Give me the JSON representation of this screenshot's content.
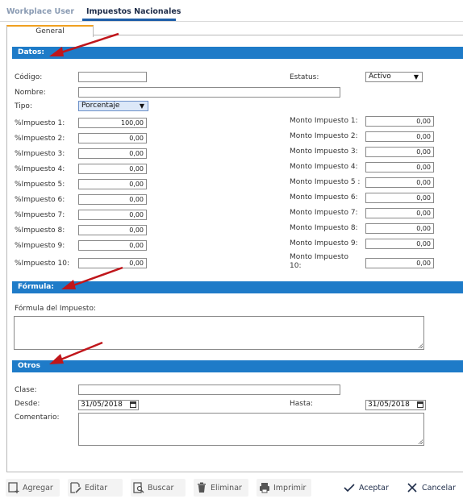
{
  "top_tabs": [
    "Workplace User",
    "Impuestos Nacionales"
  ],
  "subtab": "General",
  "sections": {
    "datos": "Datos:",
    "formula": "Fórmula:",
    "otros": "Otros"
  },
  "fields": {
    "codigo_label": "Código:",
    "codigo_value": "",
    "nombre_label": "Nombre:",
    "nombre_value": "",
    "tipo_label": "Tipo:",
    "tipo_value": "Porcentaje",
    "estatus_label": "Estatus:",
    "estatus_value": "Activo"
  },
  "impuestos": [
    {
      "label": "%Impuesto 1:",
      "value": "100,00"
    },
    {
      "label": "%Impuesto 2:",
      "value": "0,00"
    },
    {
      "label": "%Impuesto 3:",
      "value": "0,00"
    },
    {
      "label": "%Impuesto 4:",
      "value": "0,00"
    },
    {
      "label": "%Impuesto 5:",
      "value": "0,00"
    },
    {
      "label": "%Impuesto 6:",
      "value": "0,00"
    },
    {
      "label": "%Impuesto 7:",
      "value": "0,00"
    },
    {
      "label": "%Impuesto 8:",
      "value": "0,00"
    },
    {
      "label": "%Impuesto 9:",
      "value": "0,00"
    },
    {
      "label": "%Impuesto 10:",
      "value": "0,00"
    }
  ],
  "montos": [
    {
      "label": "Monto Impuesto 1:",
      "value": "0,00"
    },
    {
      "label": "Monto Impuesto 2:",
      "value": "0,00"
    },
    {
      "label": "Monto Impuesto 3:",
      "value": "0,00"
    },
    {
      "label": "Monto Impuesto 4:",
      "value": "0,00"
    },
    {
      "label": "Monto Impuesto 5 :",
      "value": "0,00"
    },
    {
      "label": "Monto Impuesto 6:",
      "value": "0,00"
    },
    {
      "label": "Monto Impuesto 7:",
      "value": "0,00"
    },
    {
      "label": "Monto Impuesto 8:",
      "value": "0,00"
    },
    {
      "label": "Monto Impuesto 9:",
      "value": "0,00"
    },
    {
      "label_line1": "Monto Impuesto",
      "label_line2": "10:",
      "value": "0,00"
    }
  ],
  "formula": {
    "label": "Fórmula del Impuesto:",
    "value": ""
  },
  "otros": {
    "clase_label": "Clase:",
    "clase_value": "",
    "desde_label": "Desde:",
    "desde_value": "31/05/2018",
    "hasta_label": "Hasta:",
    "hasta_value": "31/05/2018",
    "comentario_label": "Comentario:",
    "comentario_value": ""
  },
  "toolbar": {
    "agregar": "Agregar",
    "editar": "Editar",
    "buscar": "Buscar",
    "eliminar": "Eliminar",
    "imprimir": "Imprimir",
    "aceptar": "Aceptar",
    "cancelar": "Cancelar"
  },
  "colors": {
    "section_bar": "#1e7bc8",
    "tab_accent": "#f0a020",
    "annotation_arrow": "#c0161b"
  }
}
